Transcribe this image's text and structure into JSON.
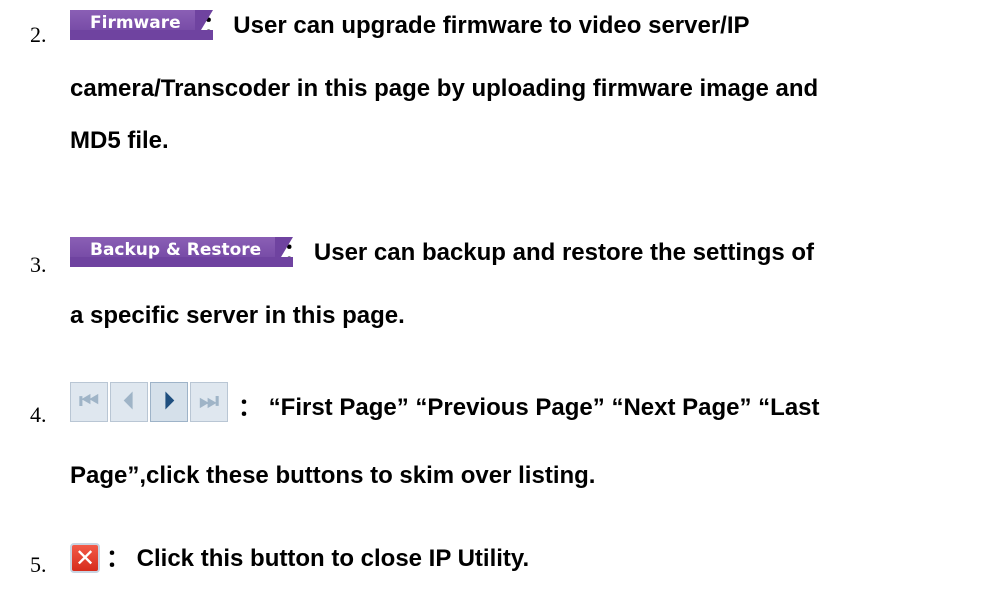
{
  "items": [
    {
      "number": "2.",
      "button_label": "Firmware",
      "lines": [
        "： User can upgrade firmware to video server/IP",
        "camera/Transcoder in this page by uploading firmware image and",
        "MD5 file."
      ]
    },
    {
      "number": "3.",
      "button_label": "Backup & Restore",
      "lines": [
        "： User can backup and restore the settings of",
        "a specific server in this page."
      ]
    },
    {
      "number": "4.",
      "nav_icons": [
        "first-page-icon",
        "previous-page-icon",
        "next-page-icon",
        "last-page-icon"
      ],
      "lines": [
        "： “First Page” “Previous Page” “Next Page” “Last",
        "Page”,click these buttons to skim over listing."
      ]
    },
    {
      "number": "5.",
      "close_icon": "close-icon",
      "lines": [
        "： Click this button to close IP Utility."
      ]
    }
  ],
  "colors": {
    "tab_button": "#6f43a0",
    "nav_active": "#1f4f7f",
    "nav_inactive": "#9fb4c7",
    "close_button": "#d62c1c"
  }
}
